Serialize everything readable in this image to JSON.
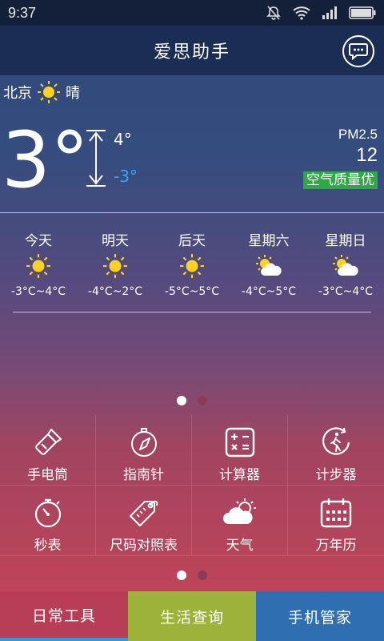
{
  "status_bar": {
    "time": "9:37",
    "icons": [
      "mute-icon",
      "wifi-icon",
      "signal-icon",
      "battery-icon"
    ]
  },
  "header": {
    "title": "爱思助手",
    "chat_icon": "chat-icon"
  },
  "weather": {
    "city": "北京",
    "condition": "晴",
    "current_temp": "3°",
    "high": "4°",
    "low": "-3°",
    "pm_label": "PM2.5",
    "pm_value": "12",
    "air_quality": "空气质量优"
  },
  "forecast": [
    {
      "day": "今天",
      "icon": "sun-icon",
      "temp": "-3°C~4°C"
    },
    {
      "day": "明天",
      "icon": "sun-icon",
      "temp": "-4°C~2°C"
    },
    {
      "day": "后天",
      "icon": "sun-icon",
      "temp": "-5°C~5°C"
    },
    {
      "day": "星期六",
      "icon": "partly-cloudy-icon",
      "temp": "-4°C~5°C"
    },
    {
      "day": "星期日",
      "icon": "partly-cloudy-icon",
      "temp": "-3°C~4°C"
    }
  ],
  "tools": [
    {
      "label": "手电筒",
      "icon": "flashlight-icon"
    },
    {
      "label": "指南针",
      "icon": "compass-icon"
    },
    {
      "label": "计算器",
      "icon": "calculator-icon"
    },
    {
      "label": "计步器",
      "icon": "pedometer-icon"
    },
    {
      "label": "秒表",
      "icon": "stopwatch-icon"
    },
    {
      "label": "尺码对照表",
      "icon": "size-tag-icon"
    },
    {
      "label": "天气",
      "icon": "weather-icon"
    },
    {
      "label": "万年历",
      "icon": "calendar-icon"
    }
  ],
  "bottom_tabs": [
    {
      "label": "日常工具",
      "active": true
    },
    {
      "label": "生活查询",
      "active": false
    },
    {
      "label": "手机管家",
      "active": false
    }
  ],
  "colors": {
    "air_quality_bg": "#2daa45",
    "low_temp": "#2ea6ff",
    "tab_daily": "#b83e58",
    "tab_life": "#9cb23a",
    "tab_manager": "#2f6fb1"
  }
}
